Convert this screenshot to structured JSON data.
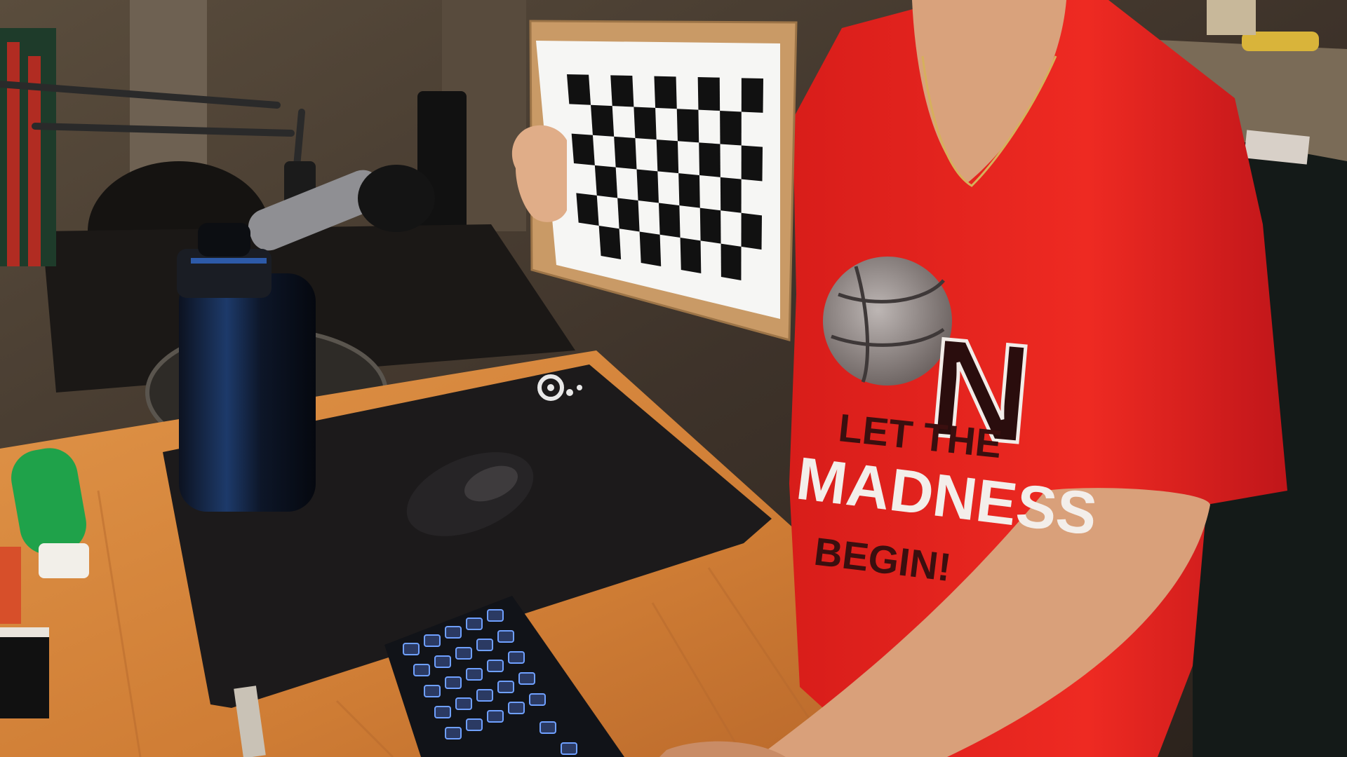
{
  "scene": {
    "shirt": {
      "letter": "N",
      "line1": "LET THE",
      "line2": "MADNESS",
      "line3": "BEGIN!"
    },
    "checkerboard": {
      "rows": 6,
      "cols": 9
    },
    "colors": {
      "wall": "#4a3f33",
      "desk": "#d9883f",
      "shirt": "#e8231f",
      "mousepad": "#1c1a1b",
      "cardboard": "#c99a66",
      "keyboard_glow": "#6fa0ff",
      "tube_green": "#1fa24a"
    }
  }
}
